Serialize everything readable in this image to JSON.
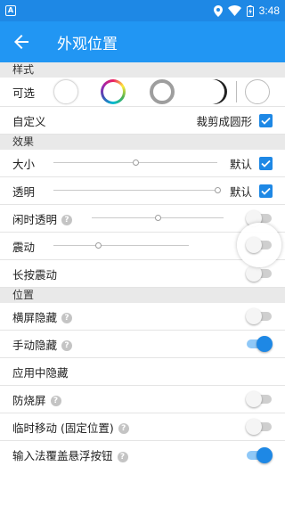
{
  "status_bar": {
    "time": "3:48",
    "notification_letter": "A"
  },
  "app_bar": {
    "title": "外观位置"
  },
  "sections": {
    "style": {
      "header": "样式",
      "selectable_label": "可选",
      "custom_label": "自定义",
      "crop_label": "裁剪成圆形",
      "crop_checked": true
    },
    "effect": {
      "header": "效果",
      "size": {
        "label": "大小",
        "default_label": "默认",
        "checked": true,
        "value": 0.5
      },
      "opacity": {
        "label": "透明",
        "default_label": "默认",
        "checked": true,
        "value": 1.0
      },
      "idle_opacity": {
        "label": "闲时透明",
        "value": 0.5,
        "enabled": false
      },
      "vibrate": {
        "label": "震动",
        "value": 0.33,
        "enabled": false
      },
      "long_press_vibrate": {
        "label": "长按震动",
        "enabled": false
      }
    },
    "position": {
      "header": "位置",
      "landscape_hide": {
        "label": "横屏隐藏",
        "enabled": false
      },
      "manual_hide": {
        "label": "手动隐藏",
        "enabled": true
      },
      "in_app_hide": {
        "label": "应用中隐藏"
      },
      "anti_burn": {
        "label": "防烧屏",
        "enabled": false
      },
      "temp_move": {
        "label": "临时移动 (固定位置)",
        "enabled": false
      },
      "ime_cover": {
        "label": "输入法覆盖悬浮按钮",
        "enabled": true
      }
    }
  },
  "colors": {
    "status_bar": "#1e88e5",
    "app_bar": "#2196f3",
    "accent": "#1e88e5",
    "section_bg": "#e9e9e9"
  }
}
